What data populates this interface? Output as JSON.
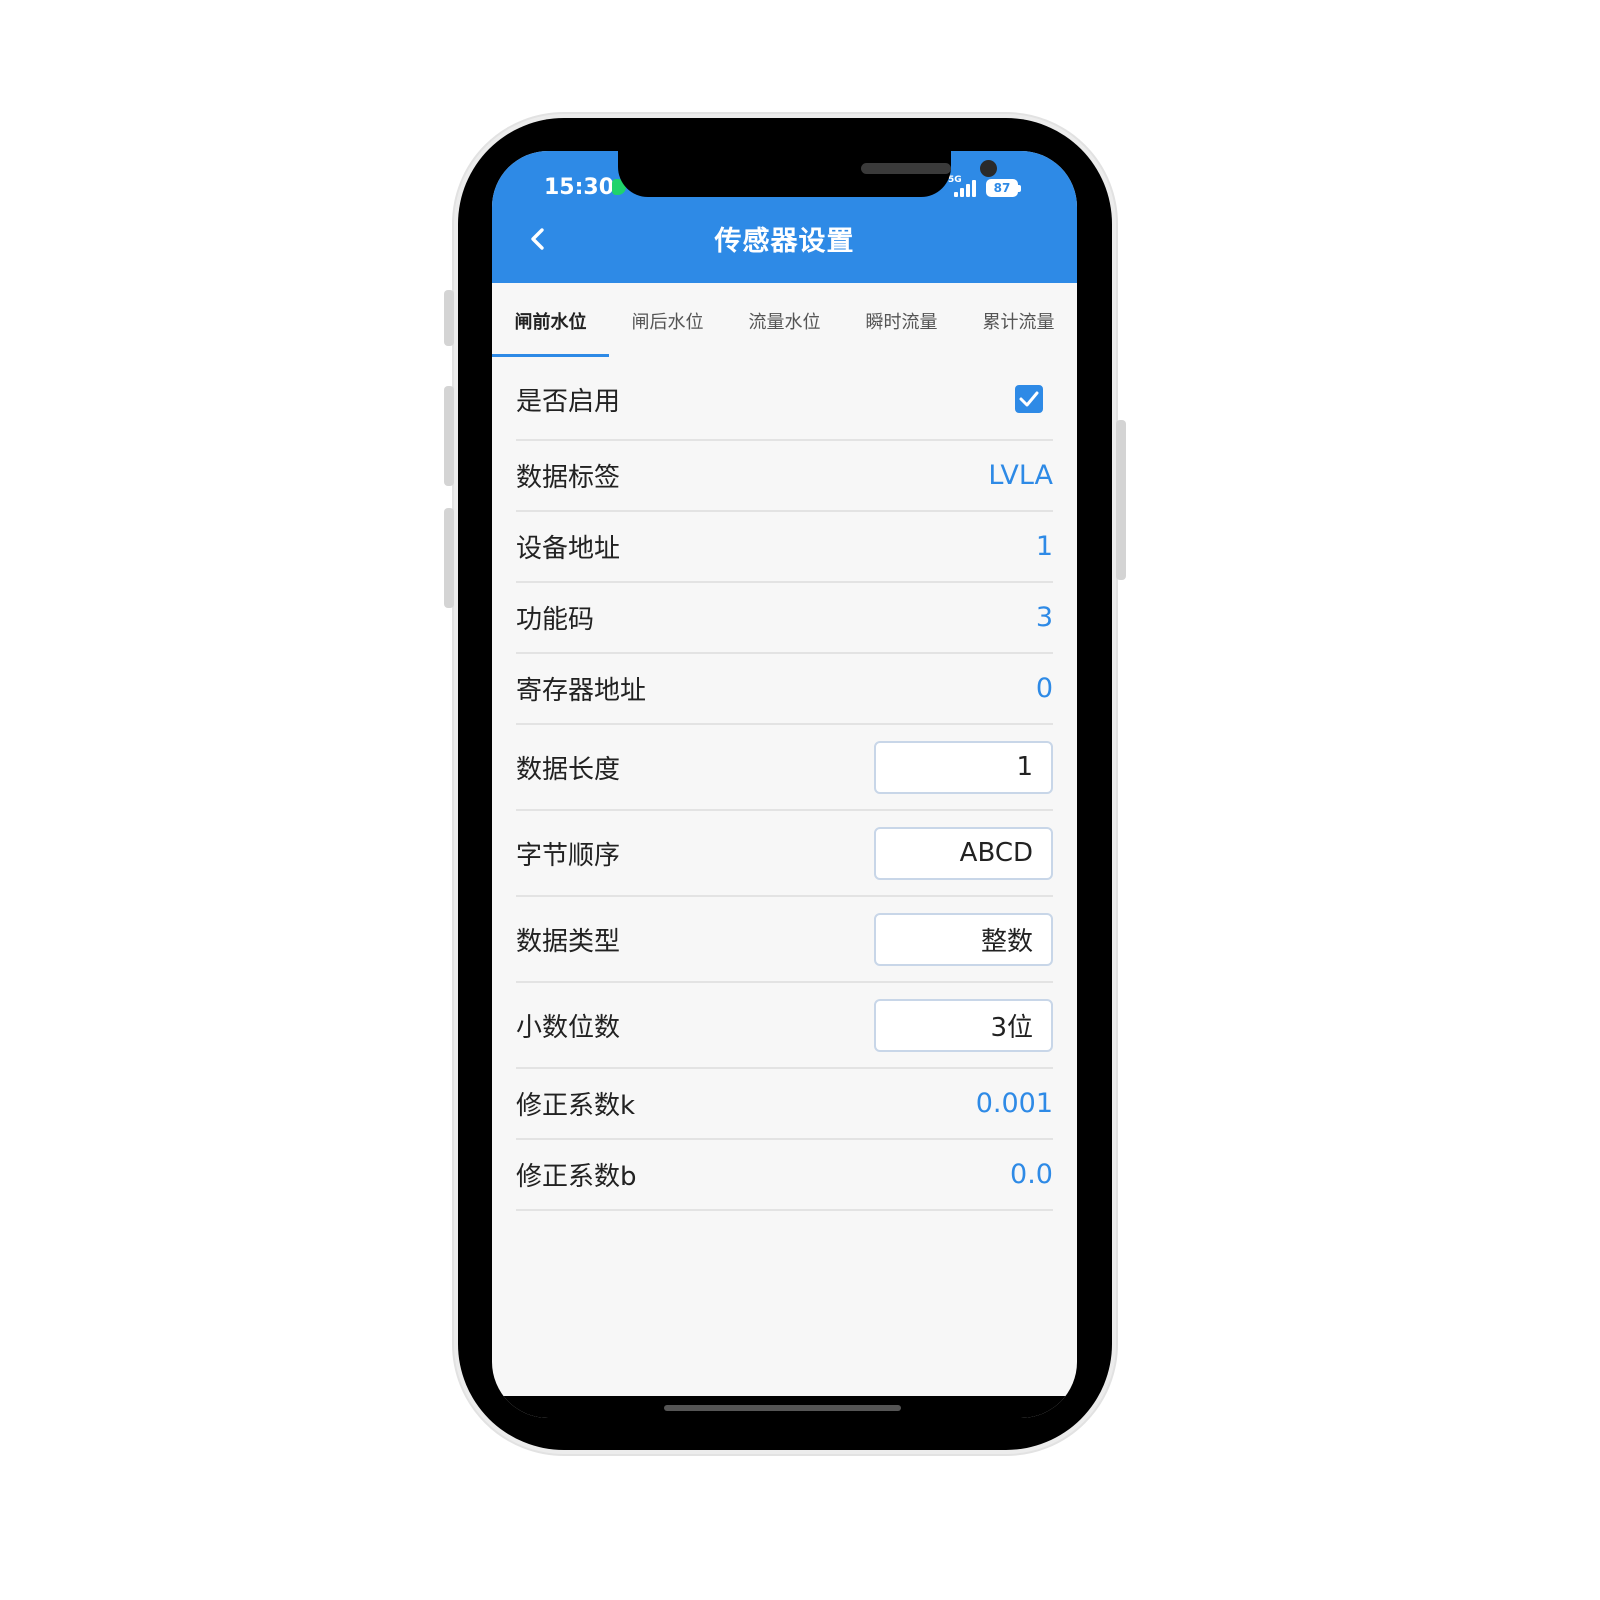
{
  "status_bar": {
    "time": "15:30",
    "network": "5G",
    "battery": "87"
  },
  "app_bar": {
    "title": "传感器设置",
    "back_icon": "chevron-left-icon"
  },
  "tabs": [
    {
      "label": "闸前水位",
      "active": true
    },
    {
      "label": "闸后水位",
      "active": false
    },
    {
      "label": "流量水位",
      "active": false
    },
    {
      "label": "瞬时流量",
      "active": false
    },
    {
      "label": "累计流量",
      "active": false
    }
  ],
  "form": {
    "enabled": {
      "label": "是否启用",
      "checked": true
    },
    "data_tag": {
      "label": "数据标签",
      "value": "LVLA"
    },
    "device_address": {
      "label": "设备地址",
      "value": "1"
    },
    "function_code": {
      "label": "功能码",
      "value": "3"
    },
    "register_address": {
      "label": "寄存器地址",
      "value": "0"
    },
    "data_length": {
      "label": "数据长度",
      "value": "1"
    },
    "byte_order": {
      "label": "字节顺序",
      "value": "ABCD"
    },
    "data_type": {
      "label": "数据类型",
      "value": "整数"
    },
    "decimal_places": {
      "label": "小数位数",
      "value": "3位"
    },
    "coef_k": {
      "label": "修正系数k",
      "value": "0.001"
    },
    "coef_b": {
      "label": "修正系数b",
      "value": "0.0"
    }
  },
  "colors": {
    "primary": "#2e8ae6",
    "background": "#f7f7f7",
    "text": "#222222"
  }
}
